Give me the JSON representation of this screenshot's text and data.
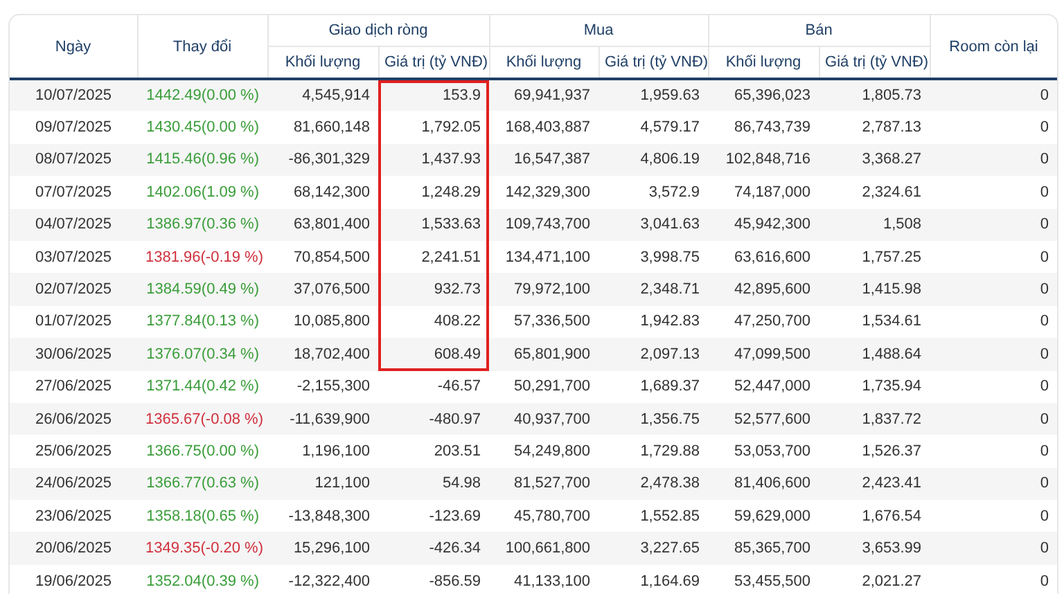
{
  "table": {
    "columns": [
      {
        "label": "Ngày"
      },
      {
        "label": "Thay đổi"
      },
      {
        "label": "Giao dịch ròng",
        "children": [
          "Khối lượng",
          "Giá trị (tỷ VNĐ)"
        ]
      },
      {
        "label": "Mua",
        "children": [
          "Khối lượng",
          "Giá trị (tỷ VNĐ)"
        ]
      },
      {
        "label": "Bán",
        "children": [
          "Khối lượng",
          "Giá trị (tỷ VNĐ)"
        ]
      },
      {
        "label": "Room còn lại"
      }
    ],
    "rows": [
      {
        "date": "10/07/2025",
        "change": "1442.49(0.00 %)",
        "color": "#3a9d3a",
        "net_volume": "4,545,914",
        "net_value": "153.9",
        "highlighted": true,
        "buy_volume": "69,941,937",
        "buy_value": "1,959.63",
        "sell_volume": "65,396,023",
        "sell_value": "1,805.73",
        "room": "0"
      },
      {
        "date": "09/07/2025",
        "change": "1430.45(0.00 %)",
        "color": "#3a9d3a",
        "net_volume": "81,660,148",
        "net_value": "1,792.05",
        "highlighted": true,
        "buy_volume": "168,403,887",
        "buy_value": "4,579.17",
        "sell_volume": "86,743,739",
        "sell_value": "2,787.13",
        "room": "0"
      },
      {
        "date": "08/07/2025",
        "change": "1415.46(0.96 %)",
        "color": "#3a9d3a",
        "net_volume": "-86,301,329",
        "net_value": "1,437.93",
        "highlighted": true,
        "buy_volume": "16,547,387",
        "buy_value": "4,806.19",
        "sell_volume": "102,848,716",
        "sell_value": "3,368.27",
        "room": "0"
      },
      {
        "date": "07/07/2025",
        "change": "1402.06(1.09 %)",
        "color": "#3a9d3a",
        "net_volume": "68,142,300",
        "net_value": "1,248.29",
        "highlighted": true,
        "buy_volume": "142,329,300",
        "buy_value": "3,572.9",
        "sell_volume": "74,187,000",
        "sell_value": "2,324.61",
        "room": "0"
      },
      {
        "date": "04/07/2025",
        "change": "1386.97(0.36 %)",
        "color": "#3a9d3a",
        "net_volume": "63,801,400",
        "net_value": "1,533.63",
        "highlighted": true,
        "buy_volume": "109,743,700",
        "buy_value": "3,041.63",
        "sell_volume": "45,942,300",
        "sell_value": "1,508",
        "room": "0"
      },
      {
        "date": "03/07/2025",
        "change": "1381.96(-0.19 %)",
        "color": "#d0313d",
        "net_volume": "70,854,500",
        "net_value": "2,241.51",
        "highlighted": true,
        "buy_volume": "134,471,100",
        "buy_value": "3,998.75",
        "sell_volume": "63,616,600",
        "sell_value": "1,757.25",
        "room": "0"
      },
      {
        "date": "02/07/2025",
        "change": "1384.59(0.49 %)",
        "color": "#3a9d3a",
        "net_volume": "37,076,500",
        "net_value": "932.73",
        "highlighted": true,
        "buy_volume": "79,972,100",
        "buy_value": "2,348.71",
        "sell_volume": "42,895,600",
        "sell_value": "1,415.98",
        "room": "0"
      },
      {
        "date": "01/07/2025",
        "change": "1377.84(0.13 %)",
        "color": "#3a9d3a",
        "net_volume": "10,085,800",
        "net_value": "408.22",
        "highlighted": true,
        "buy_volume": "57,336,500",
        "buy_value": "1,942.83",
        "sell_volume": "47,250,700",
        "sell_value": "1,534.61",
        "room": "0"
      },
      {
        "date": "30/06/2025",
        "change": "1376.07(0.34 %)",
        "color": "#3a9d3a",
        "net_volume": "18,702,400",
        "net_value": "608.49",
        "highlighted": true,
        "buy_volume": "65,801,900",
        "buy_value": "2,097.13",
        "sell_volume": "47,099,500",
        "sell_value": "1,488.64",
        "room": "0"
      },
      {
        "date": "27/06/2025",
        "change": "1371.44(0.42 %)",
        "color": "#3a9d3a",
        "net_volume": "-2,155,300",
        "net_value": "-46.57",
        "highlighted": false,
        "buy_volume": "50,291,700",
        "buy_value": "1,689.37",
        "sell_volume": "52,447,000",
        "sell_value": "1,735.94",
        "room": "0"
      },
      {
        "date": "26/06/2025",
        "change": "1365.67(-0.08 %)",
        "color": "#d0313d",
        "net_volume": "-11,639,900",
        "net_value": "-480.97",
        "highlighted": false,
        "buy_volume": "40,937,700",
        "buy_value": "1,356.75",
        "sell_volume": "52,577,600",
        "sell_value": "1,837.72",
        "room": "0"
      },
      {
        "date": "25/06/2025",
        "change": "1366.75(0.00 %)",
        "color": "#3a9d3a",
        "net_volume": "1,196,100",
        "net_value": "203.51",
        "highlighted": false,
        "buy_volume": "54,249,800",
        "buy_value": "1,729.88",
        "sell_volume": "53,053,700",
        "sell_value": "1,526.37",
        "room": "0"
      },
      {
        "date": "24/06/2025",
        "change": "1366.77(0.63 %)",
        "color": "#3a9d3a",
        "net_volume": "121,100",
        "net_value": "54.98",
        "highlighted": false,
        "buy_volume": "81,527,700",
        "buy_value": "2,478.38",
        "sell_volume": "81,406,600",
        "sell_value": "2,423.41",
        "room": "0"
      },
      {
        "date": "23/06/2025",
        "change": "1358.18(0.65 %)",
        "color": "#3a9d3a",
        "net_volume": "-13,848,300",
        "net_value": "-123.69",
        "highlighted": false,
        "buy_volume": "45,780,700",
        "buy_value": "1,552.85",
        "sell_volume": "59,629,000",
        "sell_value": "1,676.54",
        "room": "0"
      },
      {
        "date": "20/06/2025",
        "change": "1349.35(-0.20 %)",
        "color": "#d0313d",
        "net_volume": "15,296,100",
        "net_value": "-426.34",
        "highlighted": false,
        "buy_volume": "100,661,800",
        "buy_value": "3,227.65",
        "sell_volume": "85,365,700",
        "sell_value": "3,653.99",
        "room": "0"
      },
      {
        "date": "19/06/2025",
        "change": "1352.04(0.39 %)",
        "color": "#3a9d3a",
        "net_volume": "-12,322,400",
        "net_value": "-856.59",
        "highlighted": false,
        "buy_volume": "41,133,100",
        "buy_value": "1,164.69",
        "sell_volume": "53,455,500",
        "sell_value": "2,021.27",
        "room": "0"
      }
    ]
  }
}
